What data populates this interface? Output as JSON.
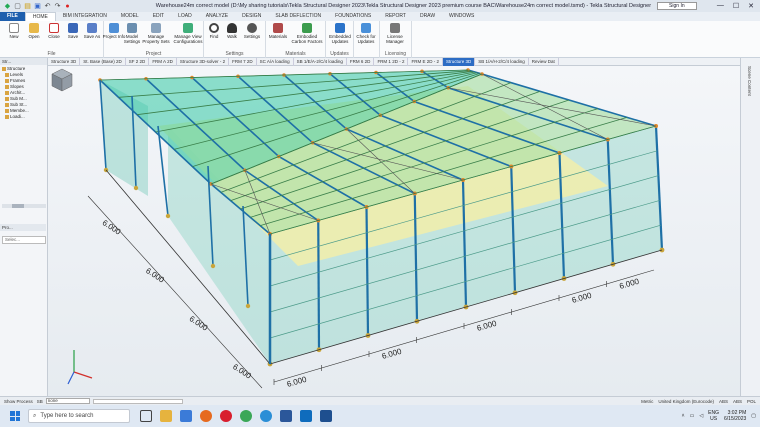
{
  "titlebar": {
    "title": "Warehouse24m correct model (D:\\My sharing tutorials\\Tekla Structural Designer 2023\\Tekla Structural Designer 2023 premium course BAC\\Warehouse24m correct model.tsmd) - Tekla Structural Designer",
    "sign_in": "Sign In",
    "minimize": "—",
    "maximize": "☐",
    "close": "✕"
  },
  "tabs": [
    "FILE",
    "HOME",
    "BIM INTEGRATION",
    "MODEL",
    "EDIT",
    "LOAD",
    "ANALYZE",
    "DESIGN",
    "SLAB DEFLECTION",
    "FOUNDATIONS",
    "REPORT",
    "DRAW",
    "WINDOWS"
  ],
  "ribbon": {
    "groups": {
      "file": "File",
      "project": "Project",
      "settings": "Settings",
      "materials": "Materials",
      "updates": "Updates",
      "licensing": "Licensing"
    },
    "buttons": {
      "new": "New",
      "open": "Open",
      "close": "Close",
      "save": "Save",
      "save_as": "Save As",
      "project_info": "Project Info",
      "model_settings": "Model Settings",
      "manage_property_sets": "Manage Property Sets",
      "manage_view_configs": "Manage View Configurations",
      "find": "Find",
      "walk": "Walk",
      "settings": "Settings",
      "materials": "Materials",
      "embodied_carbon": "Embodied Carbon Factors",
      "embedded_updates": "Embedded Updates",
      "check_for_updates": "Check for Updates",
      "license_manager": "License Manager"
    }
  },
  "doc_tabs": [
    "Structure 3D",
    "St. Base (Base) 2D",
    "SF 2 2D",
    "FRM A 2D",
    "Structure 3D-solver - 2",
    "FRM 7 2D",
    "SC A/A loading",
    "SB 1/E/A-2/C/4 loading",
    "FRM 6 2D",
    "FRM 1 2D - 2",
    "FRM E 2D - 2",
    "Structure 3D",
    "SB 1/A/H-2/C/4 loading",
    "Review Dat"
  ],
  "active_doc_tab": 11,
  "left_panel": {
    "header": "Str...",
    "tree": [
      "Structure",
      "Levels",
      "Frames",
      "Slopes",
      "Archit...",
      "Sub M...",
      "Sub St...",
      "Membe...",
      "Loadi..."
    ],
    "props_header": "Pro...",
    "props_select": "Selec..."
  },
  "right_strip": {
    "label": "Scene Content"
  },
  "viewport": {
    "dimension_label": "6.000",
    "colors": {
      "roof": "#33c9a4",
      "slab": "#f2efaa",
      "wall": "#8fd4c6",
      "column": "#1e70a6",
      "node": "#e0892b",
      "base": "#c9a53a"
    }
  },
  "status_bar": {
    "show_process": "Show Process",
    "sb": "SB",
    "selection": "none",
    "metric": "Metric",
    "region": "United Kingdom (Eurocode)",
    "modes": [
      "ABS",
      "ABS",
      "POL"
    ]
  },
  "taskbar": {
    "search_placeholder": "Type here to search",
    "language": "ENG",
    "locale": "US",
    "time": "3:02 PM",
    "date": "6/15/2023"
  }
}
